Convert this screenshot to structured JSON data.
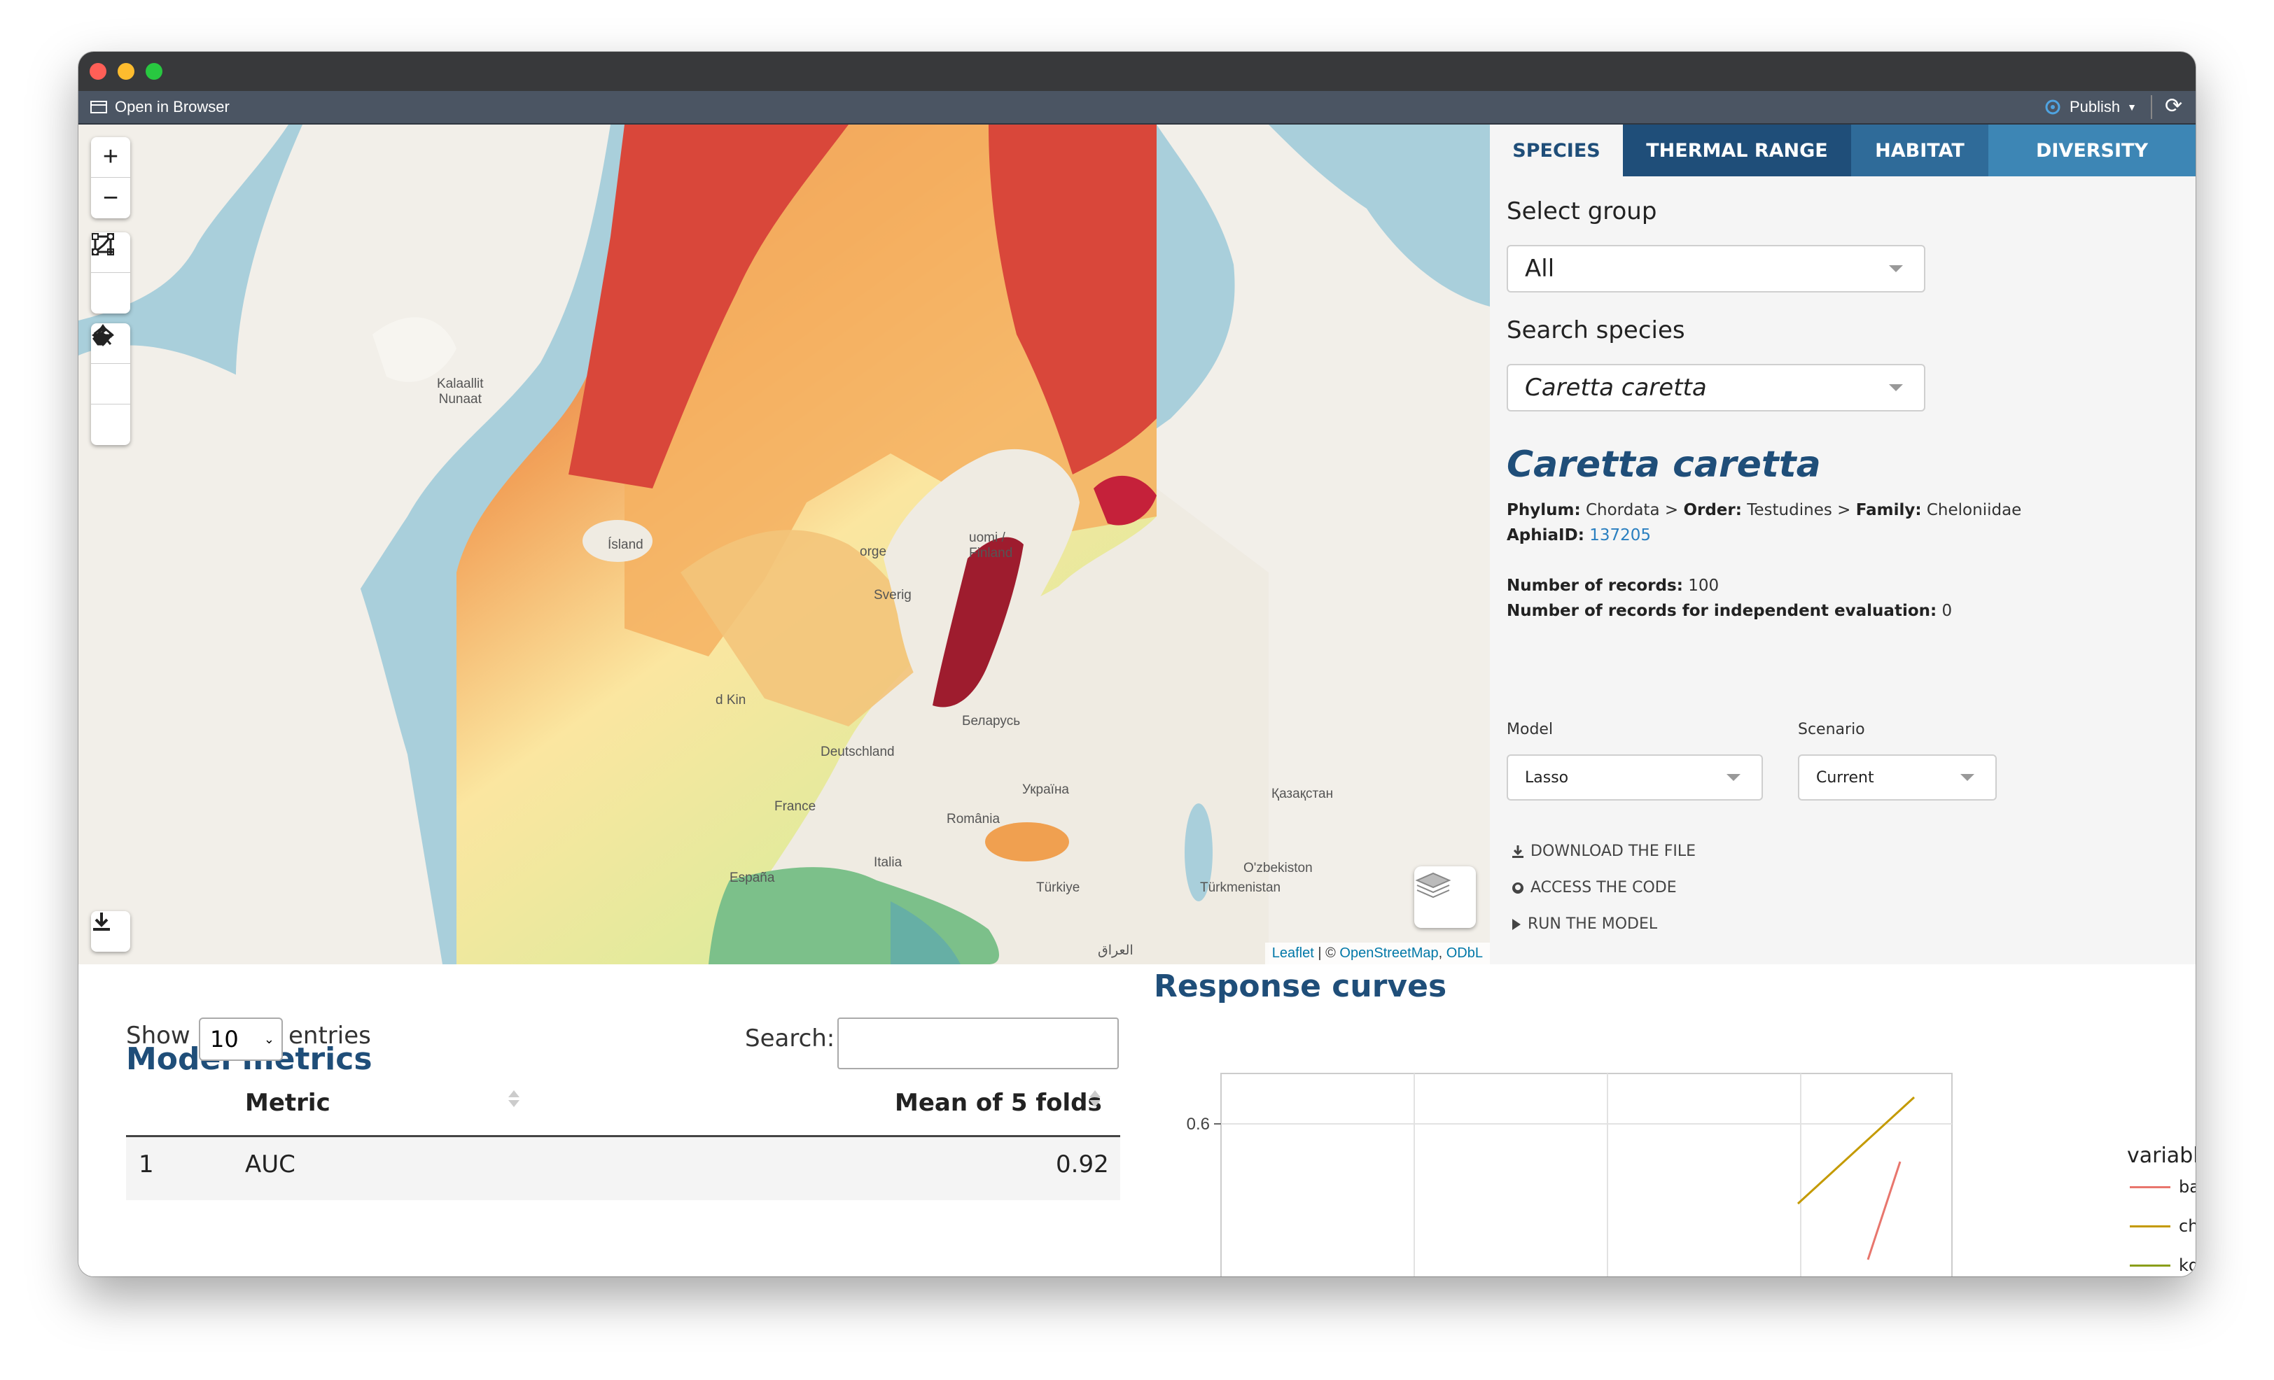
{
  "toolbar": {
    "open_in_browser": "Open in Browser",
    "publish": "Publish"
  },
  "map": {
    "labels": {
      "greenland": "Kalaallit\nNunaat",
      "iceland": "Ísland",
      "norway": "orge",
      "finland": "uomi /\nFinland",
      "sweden": "Sverig",
      "uk": "d Kin",
      "belarus": "Беларусь",
      "germany": "Deutschland",
      "ukraine": "Україна",
      "kazakhstan": "Қазақстан",
      "france": "France",
      "romania": "România",
      "spain": "España",
      "italy": "Italia",
      "turkiye": "Türkiye",
      "uzbekistan": "O'zbekiston",
      "turkmenistan": "Türkmenistan",
      "iraq": "العراق"
    },
    "attribution": {
      "leaflet": "Leaflet",
      "sep": " | © ",
      "osm": "OpenStreetMap",
      "comma": ", ",
      "odbl": "ODbL"
    }
  },
  "tabs": [
    {
      "label": "SPECIES",
      "active": true
    },
    {
      "label": "THERMAL RANGE",
      "active": false
    },
    {
      "label": "HABITAT",
      "active": false
    },
    {
      "label": "DIVERSITY",
      "active": false
    }
  ],
  "sidebar": {
    "select_group_label": "Select group",
    "select_group_value": "All",
    "search_species_label": "Search species",
    "search_species_value": "Caretta caretta",
    "species_name": "Caretta caretta",
    "phylum_label": "Phylum:",
    "phylum": "Chordata",
    "order_label": "Order:",
    "order": "Testudines",
    "family_label": "Family:",
    "family": "Cheloniidae",
    "aphia_label": "AphiaID:",
    "aphia_id": "137205",
    "records_label": "Number of records:",
    "records": "100",
    "indep_label": "Number of records for independent evaluation:",
    "indep": "0",
    "model_label": "Model",
    "model_value": "Lasso",
    "scenario_label": "Scenario",
    "scenario_value": "Current",
    "download": "DOWNLOAD THE FILE",
    "access_code": "ACCESS THE CODE",
    "run_model": "RUN THE MODEL"
  },
  "metrics": {
    "title": "Model metrics",
    "show": "Show",
    "entries_value": "10",
    "entries": "entries",
    "search": "Search:",
    "columns": [
      "Metric",
      "Mean of 5 folds"
    ],
    "rows": [
      {
        "index": "1",
        "metric": "AUC",
        "mean": "0.92"
      }
    ]
  },
  "response": {
    "title": "Response curves"
  },
  "chart_data": {
    "type": "line",
    "title": "",
    "ylabel": "",
    "xlabel": "",
    "y_ticks": [
      "0.6"
    ],
    "legend_title": "variable",
    "series": [
      {
        "name": "bathymetry",
        "color": "#e8766d"
      },
      {
        "name": "chl_mean",
        "color": "#c49a00"
      },
      {
        "name": "kdpar_mean",
        "color": "#8a9e1a"
      }
    ],
    "legend_position": "right"
  },
  "colors": {
    "accent": "#1f4e79",
    "tab_active_bg": "#ffffff",
    "tab_bg": "#2c5f8a",
    "link": "#2a7fc0"
  }
}
